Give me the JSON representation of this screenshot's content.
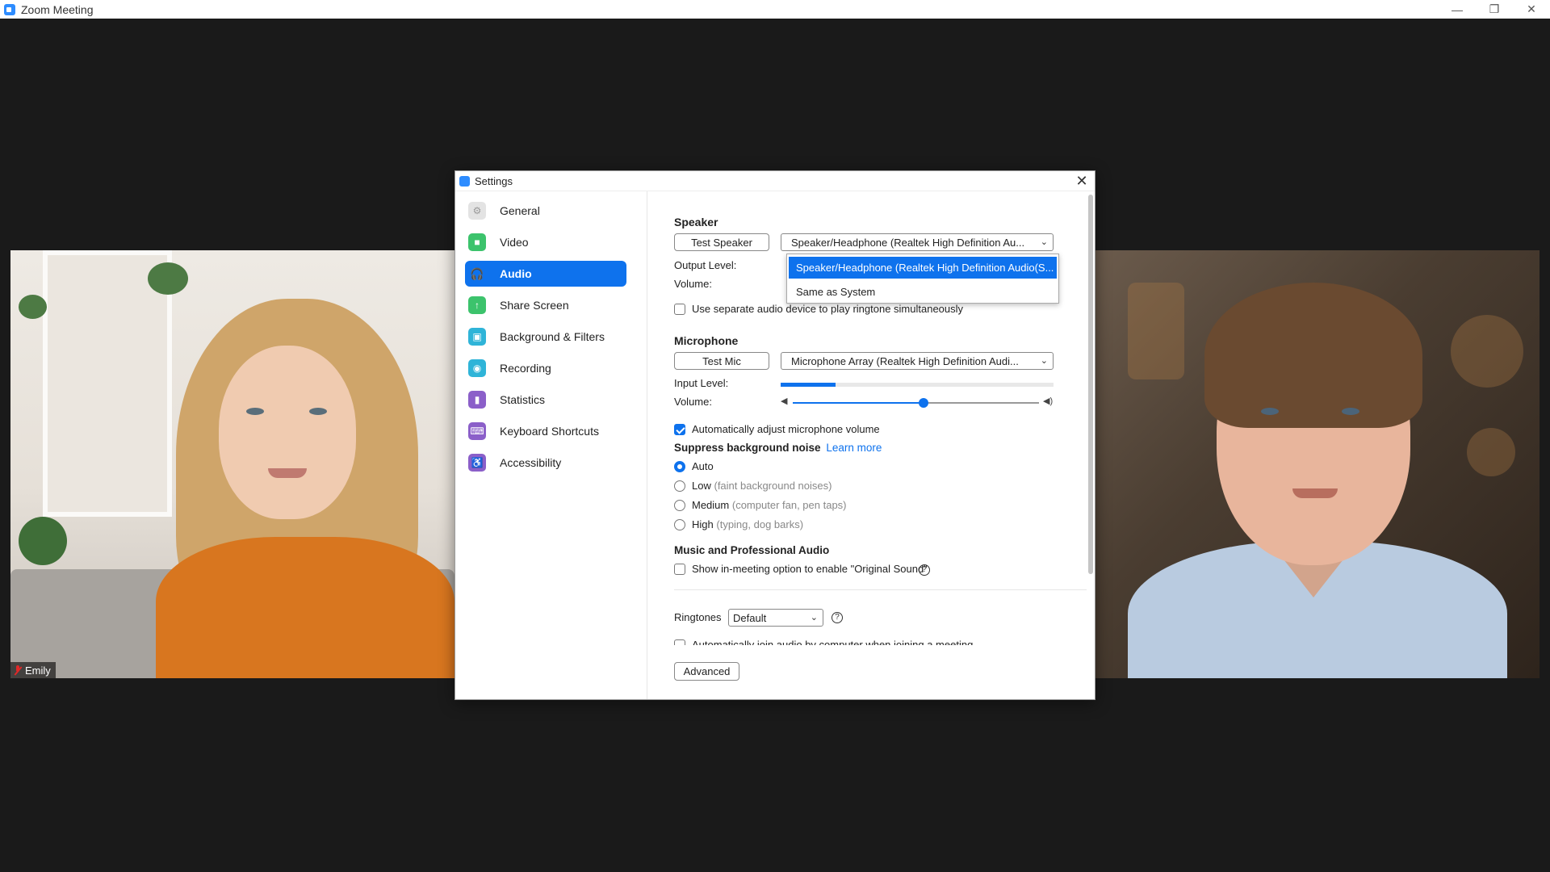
{
  "window": {
    "title": "Zoom Meeting",
    "controls": {
      "minimize": "—",
      "restore": "❐",
      "close": "✕"
    }
  },
  "participants": [
    {
      "name": "Emily",
      "muted": true
    },
    {
      "name": ""
    }
  ],
  "settings": {
    "title": "Settings",
    "close": "✕",
    "nav": [
      {
        "label": "General",
        "icon": "gear-icon",
        "color": "#e6e6e6"
      },
      {
        "label": "Video",
        "icon": "video-camera-icon",
        "color": "#3cc36c"
      },
      {
        "label": "Audio",
        "icon": "headphones-icon",
        "color": "#0e72ed",
        "active": true
      },
      {
        "label": "Share Screen",
        "icon": "share-screen-icon",
        "color": "#3cc36c"
      },
      {
        "label": "Background & Filters",
        "icon": "background-person-icon",
        "color": "#2fb4d8"
      },
      {
        "label": "Recording",
        "icon": "record-icon",
        "color": "#2fb4d8"
      },
      {
        "label": "Statistics",
        "icon": "statistics-icon",
        "color": "#8b5fc9"
      },
      {
        "label": "Keyboard Shortcuts",
        "icon": "keyboard-icon",
        "color": "#8b5fc9"
      },
      {
        "label": "Accessibility",
        "icon": "accessibility-icon",
        "color": "#8b5fc9"
      }
    ],
    "speaker": {
      "title": "Speaker",
      "test_button": "Test Speaker",
      "device": "Speaker/Headphone (Realtek High Definition Au...",
      "output_level_label": "Output Level:",
      "volume_label": "Volume:",
      "dropdown_options": [
        "Speaker/Headphone (Realtek High Definition Audio(S...",
        "Same as System"
      ],
      "selected_option_index": 0
    },
    "ringtone_separate": {
      "label": "Use separate audio device to play ringtone simultaneously",
      "checked": false
    },
    "microphone": {
      "title": "Microphone",
      "test_button": "Test Mic",
      "device": "Microphone Array (Realtek High Definition Audi...",
      "input_level_label": "Input Level:",
      "input_level": 0.2,
      "volume_label": "Volume:",
      "volume": 0.53
    },
    "auto_adjust": {
      "label": "Automatically adjust microphone volume",
      "checked": true
    },
    "suppress": {
      "title": "Suppress background noise",
      "learn_more": "Learn more",
      "options": [
        {
          "label": "Auto",
          "hint": "",
          "checked": true
        },
        {
          "label": "Low",
          "hint": "(faint background noises)",
          "checked": false
        },
        {
          "label": "Medium",
          "hint": "(computer fan, pen taps)",
          "checked": false
        },
        {
          "label": "High",
          "hint": "(typing, dog barks)",
          "checked": false
        }
      ]
    },
    "music": {
      "title": "Music and Professional Audio",
      "original_sound": {
        "label": "Show in-meeting option to enable \"Original Sound\"",
        "checked": false
      },
      "help": "?"
    },
    "ringtones": {
      "label": "Ringtones",
      "value": "Default",
      "help": "?"
    },
    "auto_join": {
      "label": "Automatically join audio by computer when joining a meeting",
      "checked": false
    },
    "advanced_button": "Advanced"
  },
  "colors": {
    "accent": "#0e72ed",
    "brand": "#2d8cff"
  }
}
